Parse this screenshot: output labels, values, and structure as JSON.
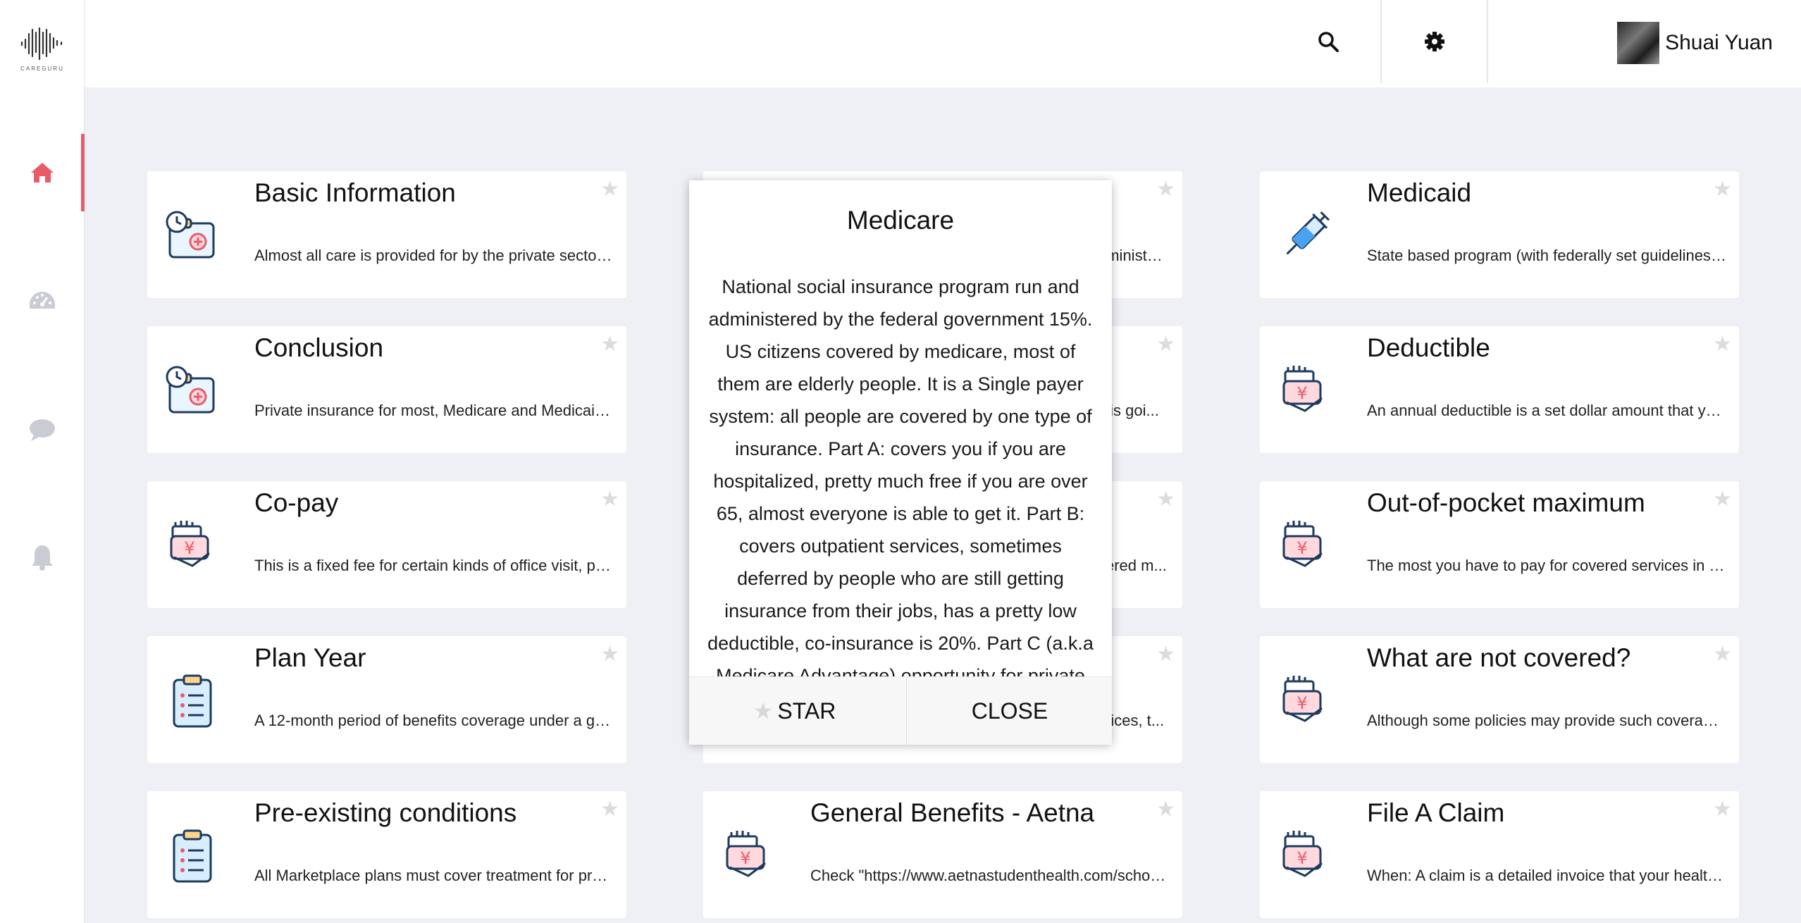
{
  "app": {
    "logo_text": "CAREGURU"
  },
  "sidebar": {
    "items": [
      {
        "name": "home",
        "icon": "home-icon",
        "active": true
      },
      {
        "name": "dashboard",
        "icon": "dashboard-icon",
        "active": false
      },
      {
        "name": "chat",
        "icon": "chat-icon",
        "active": false
      },
      {
        "name": "notifications",
        "icon": "bell-icon",
        "active": false
      }
    ],
    "accent_color": "#ea5b6a"
  },
  "header": {
    "search_icon": "search-icon",
    "settings_icon": "gear-icon",
    "user_name": "Shuai Yuan"
  },
  "cards": [
    {
      "title": "Basic Information",
      "text": "Almost all care is provided for by the private sector, t...",
      "icon": "calendar-folder-icon"
    },
    {
      "title": "",
      "text": "dministe...",
      "icon": ""
    },
    {
      "title": "Medicaid",
      "text": "State based program (with federally set guidelines), p...",
      "icon": "syringe-icon"
    },
    {
      "title": "Conclusion",
      "text": "Private insurance for most, Medicare and Medicaid fo...",
      "icon": "calendar-folder-icon"
    },
    {
      "title": "",
      "text": "y is goi...",
      "icon": ""
    },
    {
      "title": "Deductible",
      "text": "An annual deductible is a set dollar amount that you ...",
      "icon": "yen-hand-icon"
    },
    {
      "title": "Co-pay",
      "text": "This is a fixed fee for certain kinds of office visit, pres...",
      "icon": "yen-hand-icon"
    },
    {
      "title": "",
      "text": "vered m...",
      "icon": ""
    },
    {
      "title": "Out-of-pocket maximum",
      "text": "The most you have to pay for covered services in a p...",
      "icon": "yen-hand-icon"
    },
    {
      "title": "Plan Year",
      "text": "A 12-month period of benefits coverage under a grou...",
      "icon": "clipboard-icon"
    },
    {
      "title": "",
      "text": "rvices, t...",
      "icon": ""
    },
    {
      "title": "What are not covered?",
      "text": "Although some policies may provide such coverage, ...",
      "icon": "yen-hand-icon"
    },
    {
      "title": "Pre-existing conditions",
      "text": "All Marketplace plans must cover treatment for pre-e...",
      "icon": "clipboard-icon"
    },
    {
      "title": "General Benefits - Aetna",
      "text": "Check \"https://www.aetnastudenthealth.com/schools...",
      "icon": "yen-hand-icon"
    },
    {
      "title": "File A Claim",
      "text": "When: A claim is a detailed invoice that your health-c...",
      "icon": "yen-hand-icon"
    }
  ],
  "modal": {
    "title": "Medicare",
    "body": "National social insurance program run and administered by the federal government 15%. US citizens covered by medicare, most of them are elderly people. It is a Single payer system: all people are covered by one type of insurance. Part A: covers you if you are hospitalized, pretty much free if you are over 65, almost everyone is able to get it. Part B: covers outpatient services, sometimes deferred by people who are still getting insurance from their jobs, has a pretty low deductible, co-insurance is 20%. Part C (a.k.a Medicare Advantage) opportunity for private companies to offer Medicare-like benefits as an",
    "star_label": "STAR",
    "close_label": "CLOSE"
  }
}
